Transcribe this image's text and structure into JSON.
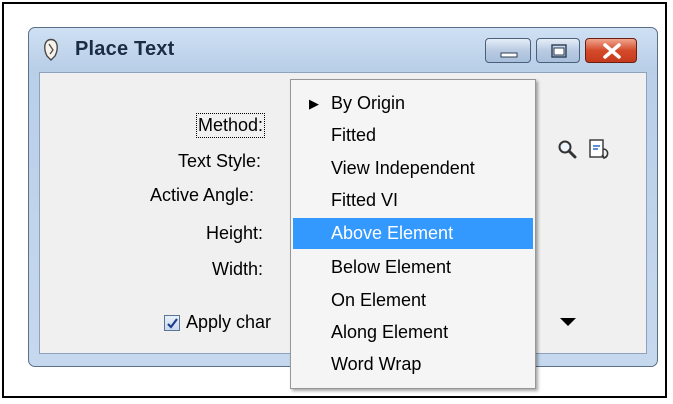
{
  "window": {
    "title": "Place Text",
    "minimize_icon": "minimize-icon",
    "maximize_icon": "maximize-icon",
    "close_icon": "close-icon"
  },
  "form": {
    "method_label": "Method:",
    "text_style_label": "Text Style:",
    "active_angle_label": "Active Angle:",
    "height_label": "Height:",
    "width_label": "Width:",
    "apply_checkbox_label": "Apply char",
    "apply_checked": true
  },
  "method_menu": {
    "items": [
      {
        "label": "By Origin",
        "checked": true,
        "selected": false
      },
      {
        "label": "Fitted",
        "checked": false,
        "selected": false
      },
      {
        "label": "View Independent",
        "checked": false,
        "selected": false
      },
      {
        "label": "Fitted VI",
        "checked": false,
        "selected": false
      },
      {
        "label": "Above Element",
        "checked": false,
        "selected": true
      },
      {
        "label": "Below Element",
        "checked": false,
        "selected": false
      },
      {
        "label": "On Element",
        "checked": false,
        "selected": false
      },
      {
        "label": "Along Element",
        "checked": false,
        "selected": false
      },
      {
        "label": "Word Wrap",
        "checked": false,
        "selected": false
      }
    ]
  },
  "icons": {
    "app": "place-text-icon",
    "magnifier": "magnifier-icon",
    "match": "match-element-icon",
    "dropdown": "dropdown-arrow-icon"
  },
  "colors": {
    "selection": "#3399ff",
    "close_button": "#d44a2a"
  }
}
